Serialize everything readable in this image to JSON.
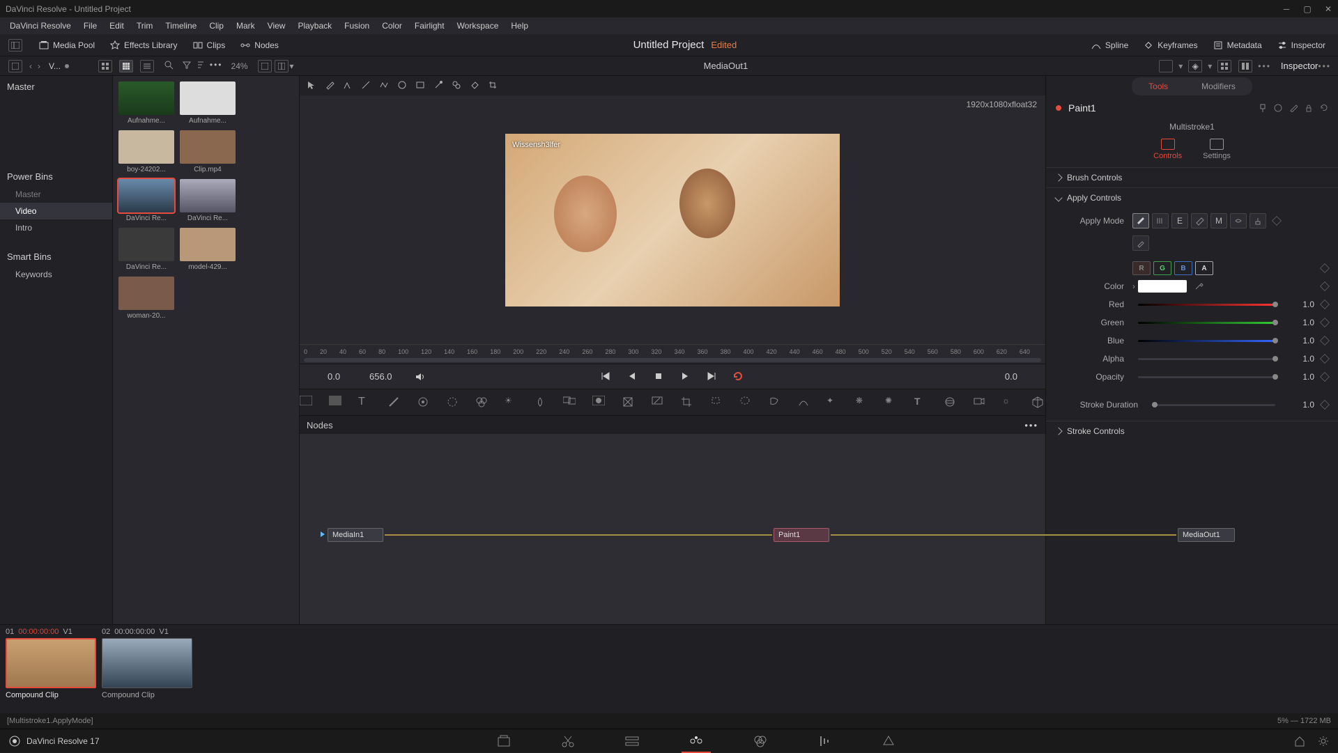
{
  "window": {
    "title": "DaVinci Resolve - Untitled Project"
  },
  "menu": [
    "DaVinci Resolve",
    "File",
    "Edit",
    "Trim",
    "Timeline",
    "Clip",
    "Mark",
    "View",
    "Playback",
    "Fusion",
    "Color",
    "Fairlight",
    "Workspace",
    "Help"
  ],
  "toolbar": {
    "mediaPool": "Media Pool",
    "effects": "Effects Library",
    "clips": "Clips",
    "nodes": "Nodes",
    "spline": "Spline",
    "keyframes": "Keyframes",
    "metadata": "Metadata",
    "inspector": "Inspector"
  },
  "project": {
    "title": "Untitled Project",
    "status": "Edited"
  },
  "subbar": {
    "vlabel": "V...",
    "zoom": "24%",
    "center": "MediaOut1",
    "inspector": "Inspector"
  },
  "leftPanel": {
    "master": "Master",
    "powerBins": "Power Bins",
    "pb_master": "Master",
    "pb_video": "Video",
    "pb_intro": "Intro",
    "smartBins": "Smart Bins",
    "sb_keywords": "Keywords"
  },
  "thumbs": [
    {
      "label": "Aufnahme..."
    },
    {
      "label": "Aufnahme..."
    },
    {
      "label": "boy-24202..."
    },
    {
      "label": "Clip.mp4"
    },
    {
      "label": "DaVinci Re...",
      "selected": true
    },
    {
      "label": "DaVinci Re..."
    },
    {
      "label": "DaVinci Re..."
    },
    {
      "label": "model-429..."
    },
    {
      "label": "woman-20..."
    }
  ],
  "viewer": {
    "meta": "1920x1080xfloat32",
    "overlay": "Wissensh3lfer"
  },
  "ruler": [
    "0",
    "20",
    "40",
    "60",
    "80",
    "100",
    "120",
    "140",
    "160",
    "180",
    "200",
    "220",
    "240",
    "260",
    "280",
    "300",
    "320",
    "340",
    "360",
    "380",
    "400",
    "420",
    "440",
    "460",
    "480",
    "500",
    "520",
    "540",
    "560",
    "580",
    "600",
    "620",
    "640"
  ],
  "transport": {
    "left": "0.0",
    "duration": "656.0",
    "right": "0.0"
  },
  "nodes": {
    "title": "Nodes",
    "n1": "MediaIn1",
    "n2": "Paint1",
    "n3": "MediaOut1"
  },
  "clips": [
    {
      "idx": "01",
      "tc": "00:00:00:00",
      "track": "V1",
      "label": "Compound Clip",
      "selected": true,
      "red": true
    },
    {
      "idx": "02",
      "tc": "00:00:00:00",
      "track": "V1",
      "label": "Compound Clip",
      "selected": false,
      "red": false
    }
  ],
  "status": {
    "left": "[Multistroke1.ApplyMode]",
    "right": "5% — 1722 MB"
  },
  "bottombar": {
    "app": "DaVinci Resolve 17"
  },
  "inspector": {
    "tabTools": "Tools",
    "tabModifiers": "Modifiers",
    "nodeName": "Paint1",
    "strokeName": "Multistroke1",
    "subControls": "Controls",
    "subSettings": "Settings",
    "brushControls": "Brush Controls",
    "applyControls": "Apply Controls",
    "applyMode": "Apply Mode",
    "chR": "R",
    "chG": "G",
    "chB": "B",
    "chA": "A",
    "color": "Color",
    "red": "Red",
    "green": "Green",
    "blue": "Blue",
    "alpha": "Alpha",
    "opacity": "Opacity",
    "valRed": "1.0",
    "valGreen": "1.0",
    "valBlue": "1.0",
    "valAlpha": "1.0",
    "valOpacity": "1.0",
    "strokeDuration": "Stroke Duration",
    "valStrokeDuration": "1.0",
    "strokeControls": "Stroke Controls"
  }
}
